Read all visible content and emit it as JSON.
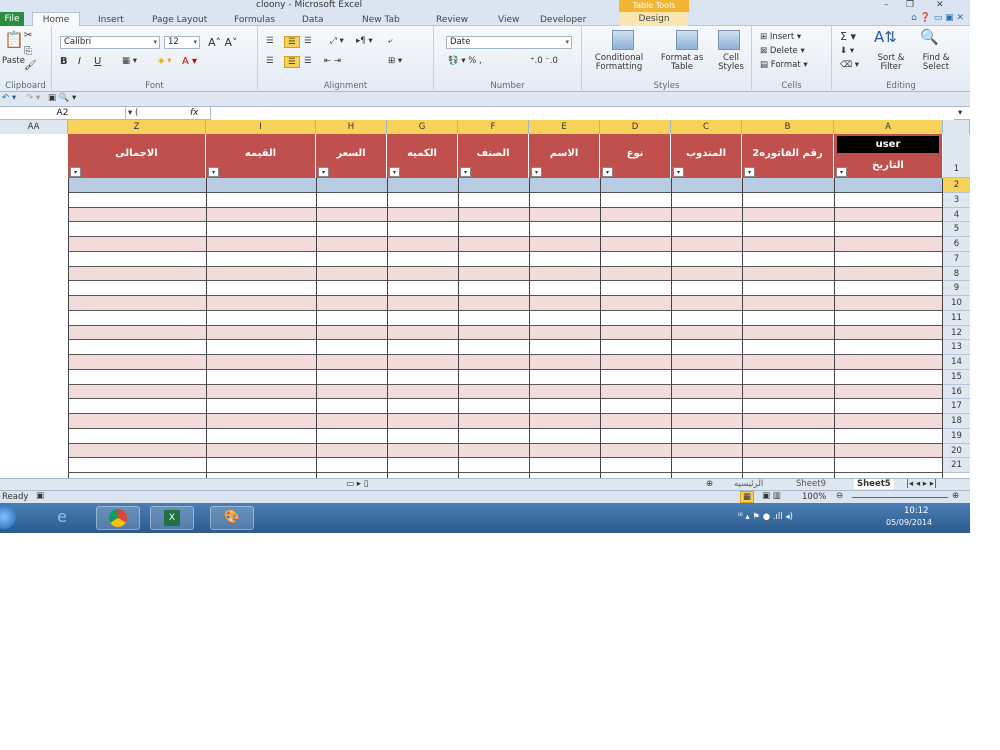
{
  "window": {
    "title": "cloony - Microsoft Excel",
    "context_tab": "Table Tools"
  },
  "tabs": [
    {
      "label": "File"
    },
    {
      "label": "Home"
    },
    {
      "label": "Insert"
    },
    {
      "label": "Page Layout"
    },
    {
      "label": "Formulas"
    },
    {
      "label": "Data"
    },
    {
      "label": "New Tab"
    },
    {
      "label": "Review"
    },
    {
      "label": "View"
    },
    {
      "label": "Developer"
    },
    {
      "label": "Design"
    }
  ],
  "ribbon": {
    "clipboard": {
      "label": "Clipboard",
      "paste": "Paste"
    },
    "font": {
      "label": "Font",
      "name": "Calibri",
      "size": "12"
    },
    "alignment": {
      "label": "Alignment"
    },
    "number": {
      "label": "Number",
      "format": "Date"
    },
    "styles": {
      "label": "Styles",
      "conditional": "Conditional Formatting",
      "format_table": "Format as Table",
      "cell_styles": "Cell Styles"
    },
    "cells": {
      "label": "Cells",
      "insert": "Insert",
      "delete": "Delete",
      "format": "Format"
    },
    "editing": {
      "label": "Editing",
      "sort": "Sort & Filter",
      "find": "Find & Select"
    }
  },
  "formula_bar": {
    "name_box": "A2",
    "fx": "fx",
    "value": ""
  },
  "grid": {
    "columns": [
      "AA",
      "Z",
      "I",
      "H",
      "G",
      "F",
      "E",
      "D",
      "C",
      "B",
      "A"
    ],
    "headers": [
      "الاجمالى",
      "القيمه",
      "السعر",
      "الكميه",
      "الصنف",
      "الاسم",
      "نوع",
      "المندوب",
      "رقم الفاتوره2",
      "التاريخ"
    ],
    "user_label": "user",
    "rows": [
      "1",
      "2",
      "3",
      "4",
      "5",
      "6",
      "7",
      "8",
      "9",
      "10",
      "11",
      "12",
      "13",
      "14",
      "15",
      "16",
      "17",
      "18",
      "19",
      "20",
      "21"
    ]
  },
  "sheets": [
    "الرئيسيه",
    "Sheet9",
    "Sheet5"
  ],
  "status": {
    "ready": "Ready",
    "zoom": "100%"
  },
  "clock": {
    "time": "10:12",
    "date": "05/09/2014"
  },
  "colors": {
    "header_red": "#c0504d",
    "band_pink": "#f2dcdb",
    "selected_row": "#b8cce4"
  }
}
